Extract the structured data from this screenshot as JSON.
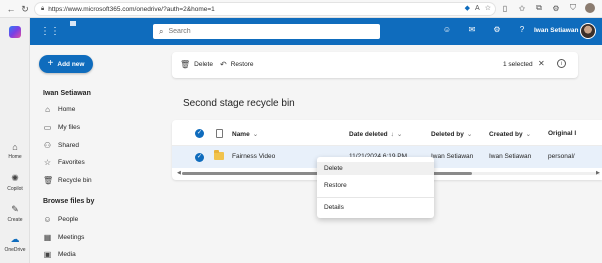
{
  "browser": {
    "url": "https://www.microsoft365.com/onedrive/?auth=2&home=1",
    "back_icon": "back-arrow-icon"
  },
  "edge_sidebar": {
    "items": [
      {
        "label": "Home",
        "icon": "home-icon"
      },
      {
        "label": "Copilot",
        "icon": "copilot-icon"
      },
      {
        "label": "Create",
        "icon": "create-icon"
      },
      {
        "label": "OneDrive",
        "icon": "onedrive-icon"
      }
    ]
  },
  "appbar": {
    "search_placeholder": "Search",
    "user_name": "Iwan Setiawan",
    "accent": "#0f6cbd"
  },
  "leftnav": {
    "new_label": "Add new",
    "user": "Iwan Setiawan",
    "items": [
      {
        "label": "Home",
        "icon": "home-icon"
      },
      {
        "label": "My files",
        "icon": "folder-icon"
      },
      {
        "label": "Shared",
        "icon": "people-icon"
      },
      {
        "label": "Favorites",
        "icon": "star-icon"
      },
      {
        "label": "Recycle bin",
        "icon": "trash-icon"
      }
    ],
    "section_title": "Browse files by",
    "browse": [
      {
        "label": "People",
        "icon": "person-icon"
      },
      {
        "label": "Meetings",
        "icon": "calendar-icon"
      },
      {
        "label": "Media",
        "icon": "image-icon"
      }
    ]
  },
  "cmdbar": {
    "delete_label": "Delete",
    "restore_label": "Restore",
    "selected_text": "1 selected"
  },
  "main": {
    "title": "Second stage recycle bin",
    "columns": {
      "name": "Name",
      "date_deleted": "Date deleted",
      "deleted_by": "Deleted by",
      "created_by": "Created by",
      "original": "Original l"
    },
    "rows": [
      {
        "name": "Fairness Video",
        "date_deleted": "11/21/2024 6:19 PM",
        "deleted_by": "Iwan Setiawan",
        "created_by": "Iwan Setiawan",
        "original": "personal/"
      }
    ]
  },
  "context_menu": {
    "items": [
      "Delete",
      "Restore",
      "Details"
    ]
  }
}
